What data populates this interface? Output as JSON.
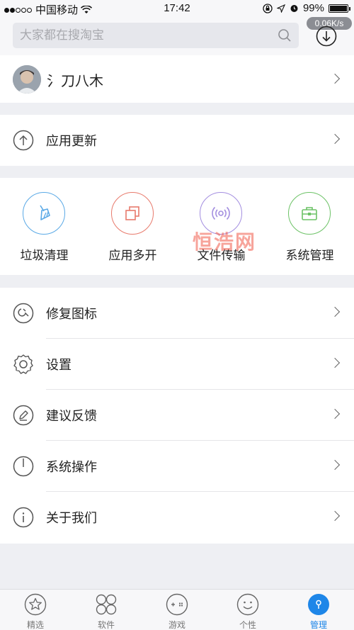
{
  "status_bar": {
    "carrier": "中国移动",
    "time": "17:42",
    "battery": "99%"
  },
  "header": {
    "search_placeholder": "大家都在搜淘宝",
    "download_speed": "0.06K/s"
  },
  "profile": {
    "name": "氵刀八木"
  },
  "update": {
    "label": "应用更新"
  },
  "tools": [
    {
      "label": "垃圾清理",
      "icon": "broom-icon",
      "color": "#5aa9e6"
    },
    {
      "label": "应用多开",
      "icon": "multi-window-icon",
      "color": "#e87a6c"
    },
    {
      "label": "文件传输",
      "icon": "signal-transfer-icon",
      "color": "#a38ee0"
    },
    {
      "label": "系统管理",
      "icon": "toolbox-icon",
      "color": "#6cc266"
    }
  ],
  "watermark": "恒浩网",
  "menu": [
    {
      "label": "修复图标",
      "icon": "repair-icon"
    },
    {
      "label": "设置",
      "icon": "gear-icon"
    },
    {
      "label": "建议反馈",
      "icon": "edit-icon"
    },
    {
      "label": "系统操作",
      "icon": "power-icon"
    },
    {
      "label": "关于我们",
      "icon": "info-icon"
    }
  ],
  "tabbar": {
    "tabs": [
      {
        "label": "精选",
        "icon": "star-icon"
      },
      {
        "label": "软件",
        "icon": "apps-grid-icon"
      },
      {
        "label": "游戏",
        "icon": "gamepad-icon"
      },
      {
        "label": "个性",
        "icon": "smiley-icon"
      },
      {
        "label": "管理",
        "icon": "manage-icon"
      }
    ],
    "active_index": 4,
    "active_color": "#1e86e8"
  }
}
